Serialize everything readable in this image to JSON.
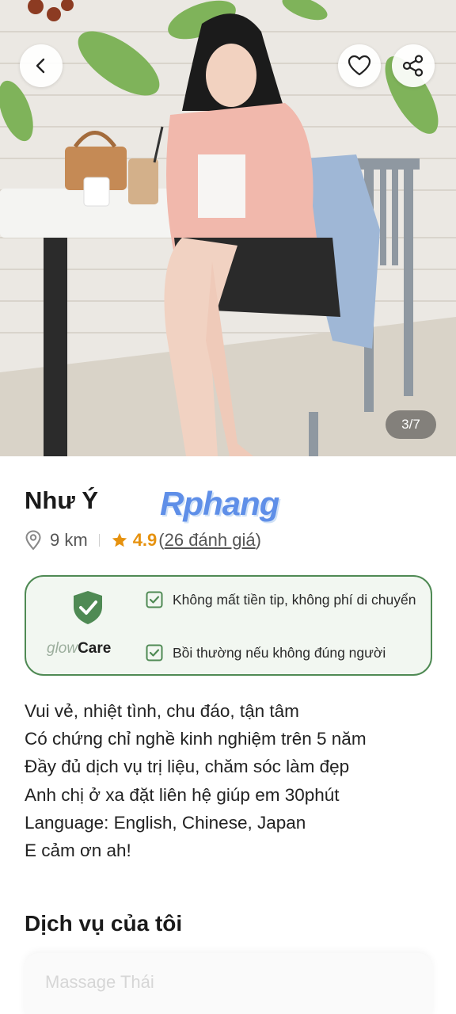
{
  "gallery": {
    "counter": "3/7",
    "back_icon": "chevron-left-icon",
    "favorite_icon": "heart-icon",
    "share_icon": "share-icon"
  },
  "profile": {
    "name": "Như Ý",
    "watermark": "Rphang",
    "distance": "9 km",
    "rating": "4.9",
    "reviews_open": "(",
    "reviews_text": "26 đánh giá",
    "reviews_close": ")"
  },
  "glow_care": {
    "brand_glow": "glow",
    "brand_care": "Care",
    "items": [
      "Không mất tiền tip, không phí di chuyển",
      "Bồi thường nếu không đúng người"
    ]
  },
  "bio": [
    "Vui vẻ, nhiệt tình, chu đáo, tận tâm",
    "Có chứng chỉ nghề kinh nghiệm trên 5 năm",
    "Đầy đủ dịch vụ trị liệu, chăm sóc làm đẹp",
    "Anh chị ở xa đặt liên hệ giúp em 30phút",
    "Language: English, Chinese, Japan",
    "E cảm ơn ah!"
  ],
  "services": {
    "title": "Dịch vụ của tôi",
    "items": [
      "Massage Thái"
    ]
  },
  "colors": {
    "accent_green": "#4f8a54",
    "rating_orange": "#e6920f",
    "care_bg": "#f2f7f1"
  }
}
